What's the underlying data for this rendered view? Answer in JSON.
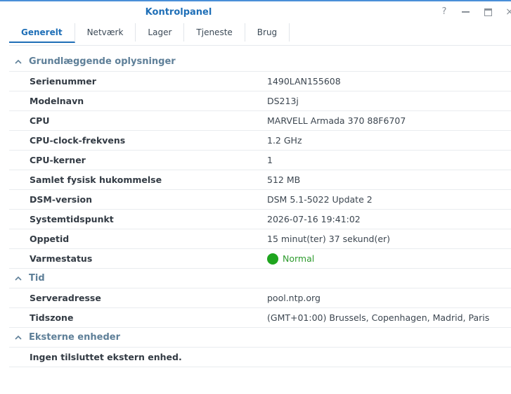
{
  "window": {
    "title": "Kontrolpanel",
    "controls": {
      "help_icon": "help-icon",
      "minimize_icon": "minimize-icon",
      "maximize_icon": "maximize-icon",
      "close_icon": "close-icon"
    },
    "accent_color": "#1f6fb7"
  },
  "tabs": [
    {
      "label": "Generelt",
      "active": true
    },
    {
      "label": "Netværk",
      "active": false
    },
    {
      "label": "Lager",
      "active": false
    },
    {
      "label": "Tjeneste",
      "active": false
    },
    {
      "label": "Brug",
      "active": false
    }
  ],
  "sections": {
    "basic": {
      "title": "Grundlæggende oplysninger",
      "rows": [
        {
          "label": "Serienummer",
          "value": "1490LAN155608"
        },
        {
          "label": "Modelnavn",
          "value": "DS213j"
        },
        {
          "label": "CPU",
          "value": "MARVELL Armada 370 88F6707"
        },
        {
          "label": "CPU-clock-frekvens",
          "value": "1.2 GHz"
        },
        {
          "label": "CPU-kerner",
          "value": "1"
        },
        {
          "label": "Samlet fysisk hukommelse",
          "value": "512 MB"
        },
        {
          "label": "DSM-version",
          "value": "DSM 5.1-5022 Update 2"
        },
        {
          "label": "Systemtidspunkt",
          "value": "2026-07-16 19:41:02"
        },
        {
          "label": "Oppetid",
          "value": "15 minut(ter) 37 sekund(er)"
        }
      ],
      "thermal": {
        "label": "Varmestatus",
        "value": "Normal",
        "status_color": "#1fa51f"
      }
    },
    "time": {
      "title": "Tid",
      "rows": [
        {
          "label": "Serveradresse",
          "value": "pool.ntp.org"
        },
        {
          "label": "Tidszone",
          "value": "(GMT+01:00) Brussels, Copenhagen, Madrid, Paris"
        }
      ]
    },
    "external": {
      "title": "Eksterne enheder",
      "message": "Ingen tilsluttet ekstern enhed."
    }
  }
}
